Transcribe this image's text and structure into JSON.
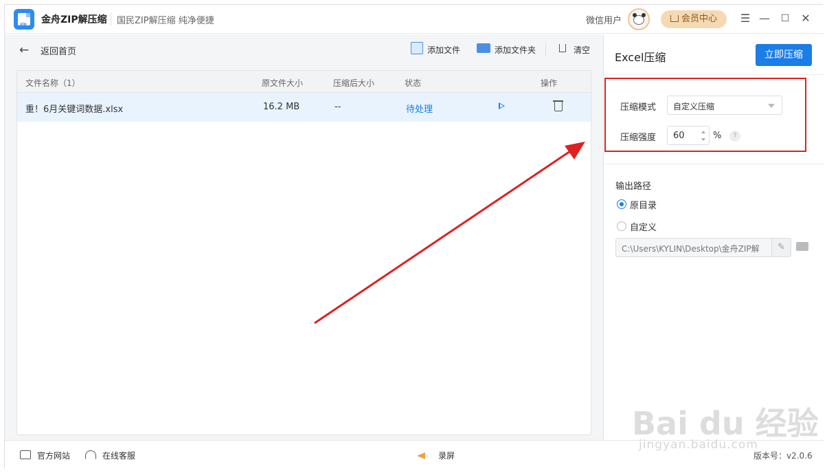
{
  "titlebar": {
    "app_name": "金舟ZIP解压缩",
    "slogan": "国民ZIP解压缩  纯净便捷",
    "username": "微信用户",
    "vip_label": "会员中心",
    "logo_text": "zip"
  },
  "toolbar": {
    "back_label": "返回首页",
    "add_file": "添加文件",
    "add_folder": "添加文件夹",
    "clear": "清空"
  },
  "table": {
    "headers": [
      "文件名称（1）",
      "原文件大小",
      "压缩后大小",
      "状态",
      "操作"
    ],
    "rows": [
      {
        "name": "重！6月关键词数据.xlsx",
        "orig_size": "16.2 MB",
        "comp_size": "--",
        "status": "待处理"
      }
    ]
  },
  "panel": {
    "title": "Excel压缩",
    "compress_button": "立即压缩",
    "mode_label": "压缩模式",
    "mode_value": "自定义压缩",
    "strength_label": "压缩强度",
    "strength_value": "60",
    "strength_unit": "%",
    "help": "?",
    "output_label": "输出路径",
    "radio_original": "原目录",
    "radio_custom": "自定义",
    "path_value": "C:\\Users\\KYLIN\\Desktop\\金舟ZIP解"
  },
  "footer": {
    "website": "官方网站",
    "service": "在线客服",
    "record": "录屏",
    "version": "版本号：v2.0.6"
  },
  "watermark": {
    "line1": "Bai du 经验",
    "line2": "jingyan.baidu.com"
  },
  "colors": {
    "accent": "#1a7de8",
    "highlight_box": "#e02020",
    "vip_bg": "#f5d9b3"
  }
}
